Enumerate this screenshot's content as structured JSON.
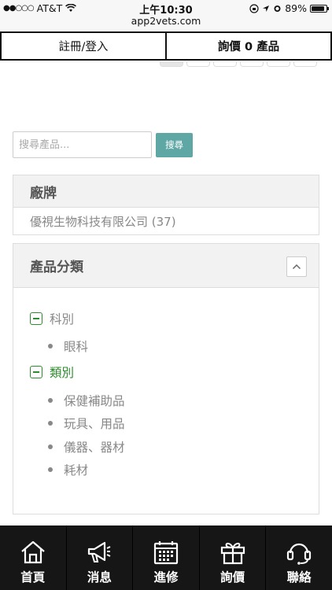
{
  "status_bar": {
    "carrier": "AT&T",
    "time": "上午10:30",
    "url": "app2vets.com",
    "battery": "89%",
    "battery_level": 0.89
  },
  "topbar": {
    "login_label": "註冊/登入",
    "inquiry_label": "詢價 0 產品"
  },
  "search": {
    "placeholder": "搜尋產品...",
    "button_label": "搜尋"
  },
  "brand_panel": {
    "title": "廠牌",
    "items": [
      {
        "label": "優視生物科技有限公司 (37)"
      }
    ]
  },
  "category_panel": {
    "title": "產品分類",
    "groups": [
      {
        "label": "科別",
        "children": [
          "眼科"
        ]
      },
      {
        "label": "類別",
        "children": [
          "保健補助品",
          "玩具、用品",
          "儀器、器材",
          "耗材"
        ]
      }
    ]
  },
  "tabbar": {
    "tabs": [
      {
        "label": "首頁",
        "icon": "home-icon"
      },
      {
        "label": "消息",
        "icon": "megaphone-icon"
      },
      {
        "label": "進修",
        "icon": "calendar-icon"
      },
      {
        "label": "詢價",
        "icon": "gift-icon"
      },
      {
        "label": "聯絡",
        "icon": "headset-icon"
      }
    ]
  },
  "colors": {
    "accent_teal": "#5fa7a4",
    "category_green": "#2e8b2e",
    "tabbar_bg": "#161616"
  }
}
